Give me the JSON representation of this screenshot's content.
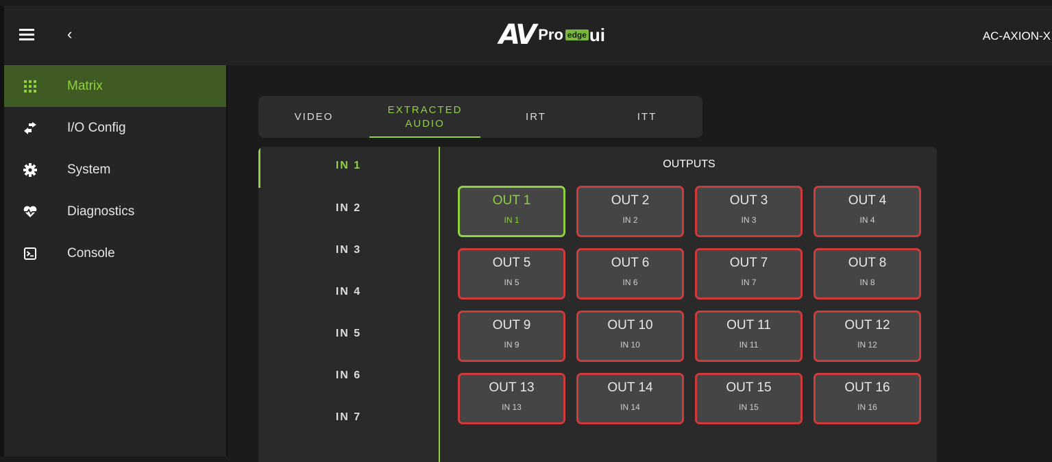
{
  "header": {
    "logo_av": "AV",
    "logo_pro": "Pro",
    "logo_edge": "edge",
    "logo_ui": "ui",
    "device_name": "AC-AXION-X"
  },
  "sidebar": {
    "items": [
      {
        "label": "Matrix",
        "icon": "grid-icon",
        "active": true
      },
      {
        "label": "I/O Config",
        "icon": "swap-arrows-icon",
        "active": false
      },
      {
        "label": "System",
        "icon": "gear-icon",
        "active": false
      },
      {
        "label": "Diagnostics",
        "icon": "heartbeat-icon",
        "active": false
      },
      {
        "label": "Console",
        "icon": "terminal-icon",
        "active": false
      }
    ]
  },
  "tabs": [
    {
      "label_line1": "VIDEO",
      "label_line2": "",
      "active": false
    },
    {
      "label_line1": "EXTRACTED",
      "label_line2": "AUDIO",
      "active": true
    },
    {
      "label_line1": "IRT",
      "label_line2": "",
      "active": false
    },
    {
      "label_line1": "ITT",
      "label_line2": "",
      "active": false
    }
  ],
  "inputs": [
    "IN 1",
    "IN 2",
    "IN 3",
    "IN 4",
    "IN 5",
    "IN 6",
    "IN 7"
  ],
  "outputs_title": "OUTPUTS",
  "outputs": [
    {
      "name": "OUT 1",
      "source": "IN 1",
      "active": true
    },
    {
      "name": "OUT 2",
      "source": "IN 2",
      "active": false
    },
    {
      "name": "OUT 3",
      "source": "IN 3",
      "active": false
    },
    {
      "name": "OUT 4",
      "source": "IN 4",
      "active": false
    },
    {
      "name": "OUT 5",
      "source": "IN 5",
      "active": false
    },
    {
      "name": "OUT 6",
      "source": "IN 6",
      "active": false
    },
    {
      "name": "OUT 7",
      "source": "IN 7",
      "active": false
    },
    {
      "name": "OUT 8",
      "source": "IN 8",
      "active": false
    },
    {
      "name": "OUT 9",
      "source": "IN 9",
      "active": false
    },
    {
      "name": "OUT 10",
      "source": "IN 10",
      "active": false
    },
    {
      "name": "OUT 11",
      "source": "IN 11",
      "active": false
    },
    {
      "name": "OUT 12",
      "source": "IN 12",
      "active": false
    },
    {
      "name": "OUT 13",
      "source": "IN 13",
      "active": false
    },
    {
      "name": "OUT 14",
      "source": "IN 14",
      "active": false
    },
    {
      "name": "OUT 15",
      "source": "IN 15",
      "active": false
    },
    {
      "name": "OUT 16",
      "source": "IN 16",
      "active": false
    }
  ],
  "colors": {
    "accent": "#8fd13f",
    "unrouted_border": "#cf3a3a"
  }
}
